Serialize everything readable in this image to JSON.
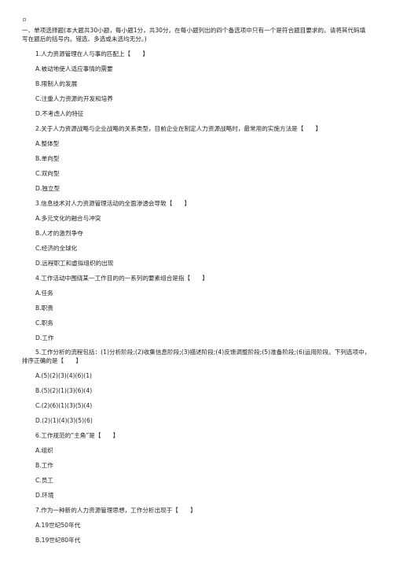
{
  "document": {
    "marker": "▫",
    "intro": "一、单项选择题(本大题共30小题，每小题1分，共30分。在每小题列出的四个备选项中只有一个是符合题目要求的。请将其代码填写在题后的括号内。错选、多选或未选均无分。)",
    "questions": [
      {
        "stem": "1.人力资源管理在人与事的匹配上【　　】",
        "options": [
          "A.被动地使人适应事情的需要",
          "B.限制人的发展",
          "C.注重人力资源的开发和培养",
          "D.不考虑人的特征"
        ]
      },
      {
        "stem": "2.关于人力资源战略与企业战略的关系类型，目前企业在制定人力资源战略时，最常用的实施方法是【　　】",
        "options": [
          "A.整体型",
          "B.单向型",
          "C.双向型",
          "D.独立型"
        ]
      },
      {
        "stem": "3.信息技术对人力资源管理活动的全面渗透会导致【　　】",
        "options": [
          "A.多元文化的融合与冲突",
          "B.人才的激烈争夺",
          "C.经济的全球化",
          "D.远程职工和虚拟组织的出现"
        ]
      },
      {
        "stem": "4.工作活动中围绕某一工作目的的一系列的要素组合是指【　　】",
        "options": [
          "A.任务",
          "B.职责",
          "C.职务",
          "D.工作"
        ]
      },
      {
        "stem": "5.工作分析的流程包括：(1)分析阶段;(2)收集信息阶段;(3)描述阶段;(4)反馈调整阶段;(5)准备阶段;(6)运用阶段。下列选项中，排序正确的是【　　】",
        "options": [
          "A.(5)(2)(3)(4)(6)(1)",
          "B.(5)(2)(1)(3)(6)(4)",
          "C.(2)(6)(1)(3)(5)(4)",
          "D.(2)(1)(4)(3)(5)(6)"
        ]
      },
      {
        "stem": "6.工作规范的“主角”是【　　】",
        "options": [
          "A.组织",
          "B.工作",
          "C.员工",
          "D.环境"
        ]
      },
      {
        "stem": "7.作为一种新的人力资源管理思想，工作分析出现于【　　】",
        "options": [
          "A.19世纪50年代",
          "B.19世纪80年代"
        ]
      }
    ]
  }
}
